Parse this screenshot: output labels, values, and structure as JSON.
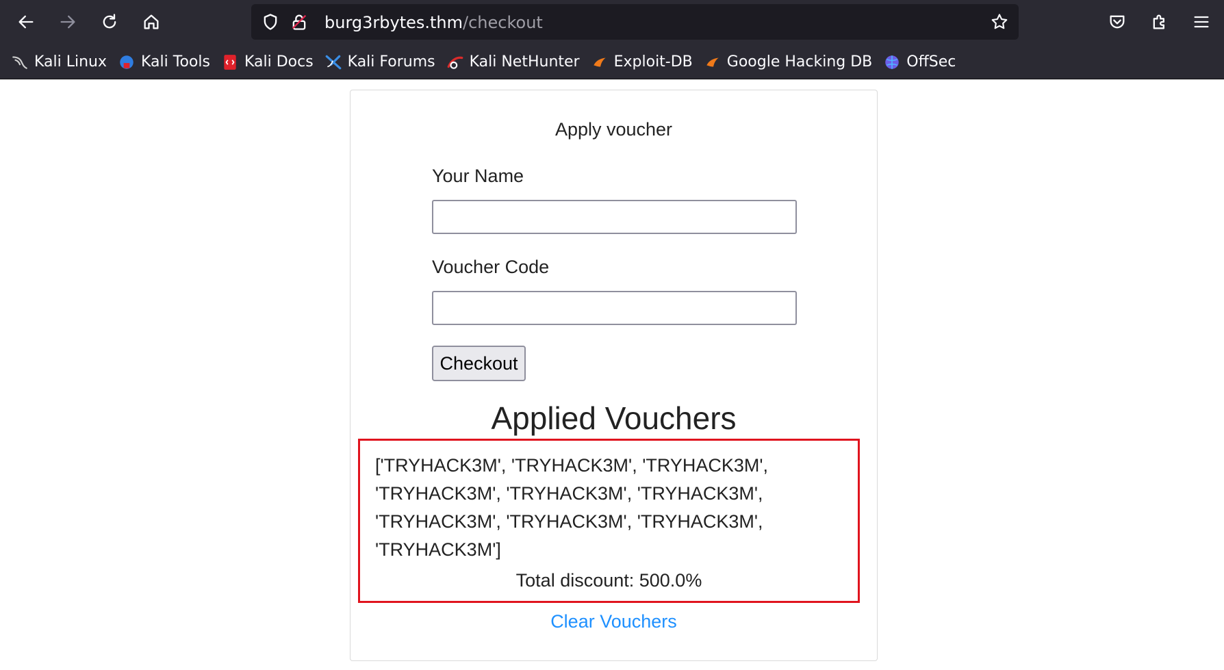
{
  "browser": {
    "url_host": "burg3rbytes.thm",
    "url_path": "/checkout",
    "toolbar_icons": [
      "back-icon",
      "forward-icon",
      "reload-icon",
      "home-icon",
      "shield-icon",
      "insecure-lock-icon",
      "star-icon",
      "pocket-icon",
      "extensions-icon",
      "menu-icon"
    ],
    "bookmarks": [
      {
        "label": "Kali Linux",
        "icon": "kali-dragon-icon",
        "color": "#d0d0d0"
      },
      {
        "label": "Kali Tools",
        "icon": "kali-tools-icon",
        "color": "#2f7de1"
      },
      {
        "label": "Kali Docs",
        "icon": "kali-docs-icon",
        "color": "#e0222b"
      },
      {
        "label": "Kali Forums",
        "icon": "kali-forums-icon",
        "color": "#3a8ee6"
      },
      {
        "label": "Kali NetHunter",
        "icon": "nethunter-icon",
        "color": "#d92b2b"
      },
      {
        "label": "Exploit-DB",
        "icon": "exploit-db-icon",
        "color": "#f07a1a"
      },
      {
        "label": "Google Hacking DB",
        "icon": "ghdb-icon",
        "color": "#f07a1a"
      },
      {
        "label": "OffSec",
        "icon": "offsec-icon",
        "color": "#6b5ee8"
      }
    ]
  },
  "page": {
    "title": "Apply voucher",
    "name_label": "Your Name",
    "name_value": "",
    "voucher_label": "Voucher Code",
    "voucher_value": "",
    "checkout_label": "Checkout",
    "applied_title": "Applied Vouchers",
    "voucher_lines": [
      "['TRYHACK3M', 'TRYHACK3M', 'TRYHACK3M',",
      "'TRYHACK3M', 'TRYHACK3M', 'TRYHACK3M',",
      "'TRYHACK3M', 'TRYHACK3M', 'TRYHACK3M',",
      "'TRYHACK3M']"
    ],
    "total_discount": "Total discount: 500.0%",
    "clear_label": "Clear Vouchers",
    "highlight_color": "#e0141e",
    "link_color": "#1e90ff"
  }
}
